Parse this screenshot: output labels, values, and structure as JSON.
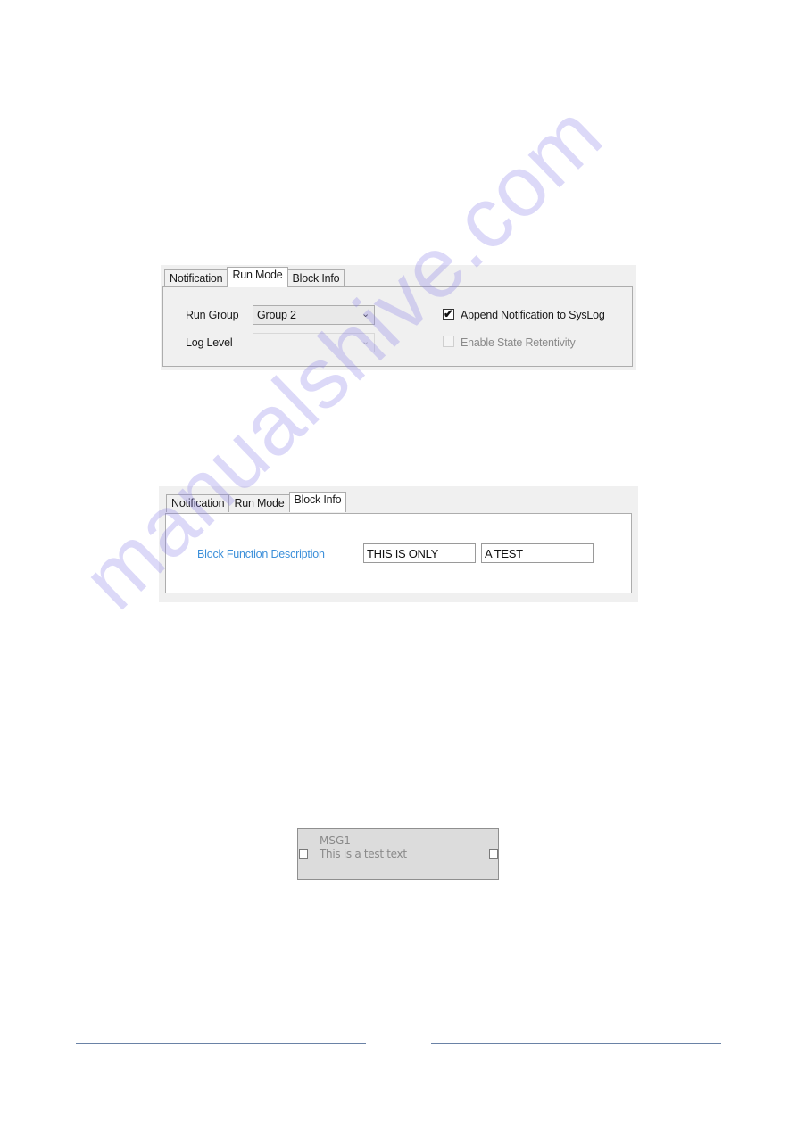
{
  "watermark": {
    "text": "manualshive.com"
  },
  "dialog_run_mode": {
    "tabs": [
      {
        "label": "Notification",
        "active": false
      },
      {
        "label": "Run Mode",
        "active": true
      },
      {
        "label": "Block Info",
        "active": false
      }
    ],
    "run_group": {
      "label": "Run Group",
      "value": "Group 2",
      "enabled": true
    },
    "log_level": {
      "label": "Log Level",
      "value": "",
      "enabled": false
    },
    "append_notification": {
      "label": "Append Notification to SysLog",
      "checked": true,
      "enabled": true
    },
    "enable_state_retentivity": {
      "label": "Enable State Retentivity",
      "checked": false,
      "enabled": false
    }
  },
  "dialog_block_info": {
    "tabs": [
      {
        "label": "Notification",
        "active": false
      },
      {
        "label": "Run Mode",
        "active": false
      },
      {
        "label": "Block Info",
        "active": true
      }
    ],
    "description_label": "Block Function Description",
    "description_field_1": "THIS IS ONLY",
    "description_field_2": "A TEST",
    "label_color": "#3b8fd9"
  },
  "msg_block": {
    "name": "MSG1",
    "text": "This is a test text"
  },
  "icons": {
    "chevron": "⌄",
    "check": "✔"
  }
}
